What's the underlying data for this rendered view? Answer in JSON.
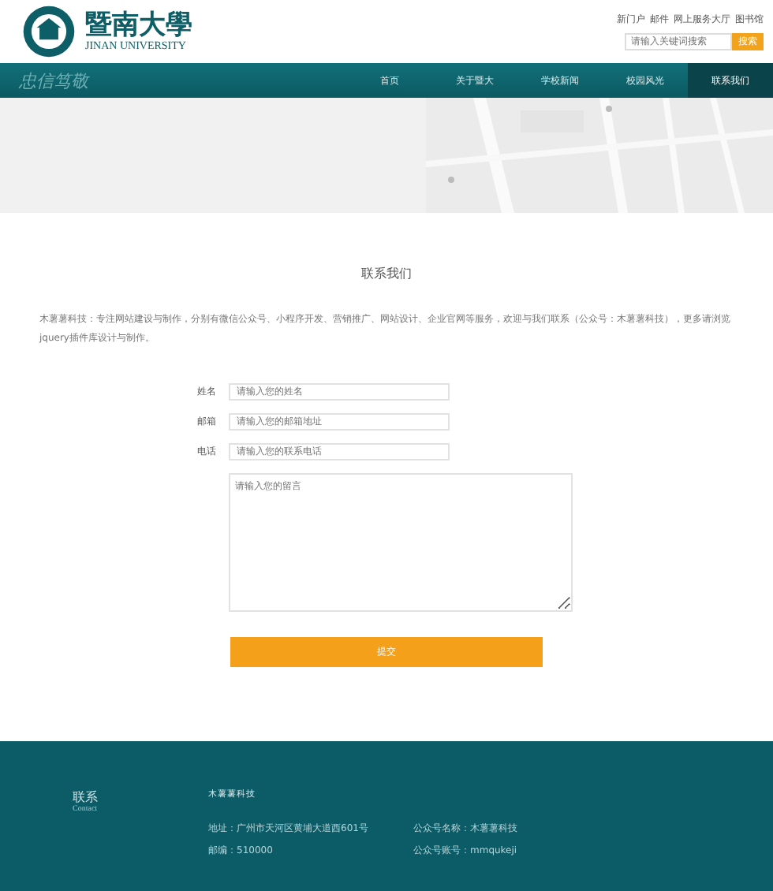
{
  "header": {
    "logo_name": "暨南大學",
    "logo_subtitle": "JINAN UNIVERSITY",
    "top_links": [
      "新门户",
      "邮件",
      "网上服务大厅",
      "图书馆"
    ],
    "search": {
      "placeholder": "请输入关键词搜索",
      "button": "搜索"
    }
  },
  "nav": {
    "slogan": "忠信笃敬",
    "items": [
      {
        "label": "首页",
        "selected": false
      },
      {
        "label": "关于暨大",
        "selected": false
      },
      {
        "label": "学校新闻",
        "selected": false
      },
      {
        "label": "校园风光",
        "selected": false
      },
      {
        "label": "联系我们",
        "selected": true
      }
    ]
  },
  "contact": {
    "title": "联系我们",
    "intro": "木薯薯科技：专注网站建设与制作，分别有微信公众号、小程序开发、营销推广、网站设计、企业官网等服务，欢迎与我们联系（公众号：木薯薯科技），更多请浏览jquery插件库设计与制作。",
    "fields": [
      {
        "label": "姓名",
        "placeholder": "请输入您的姓名",
        "kind": "input"
      },
      {
        "label": "邮箱",
        "placeholder": "请输入您的邮箱地址",
        "kind": "input"
      },
      {
        "label": "电话",
        "placeholder": "请输入您的联系电话",
        "kind": "input"
      },
      {
        "placeholder": "请输入您的留言",
        "kind": "textarea"
      }
    ],
    "submit": "提交"
  },
  "footer": {
    "title": "联系",
    "subtitle": "Contact",
    "company": "木薯薯科技",
    "lines": [
      "地址：广州市天河区黄埔大道西601号",
      "邮编：510000",
      "公众号名称：木薯薯科技",
      "公众号账号：mmqukeji"
    ]
  }
}
